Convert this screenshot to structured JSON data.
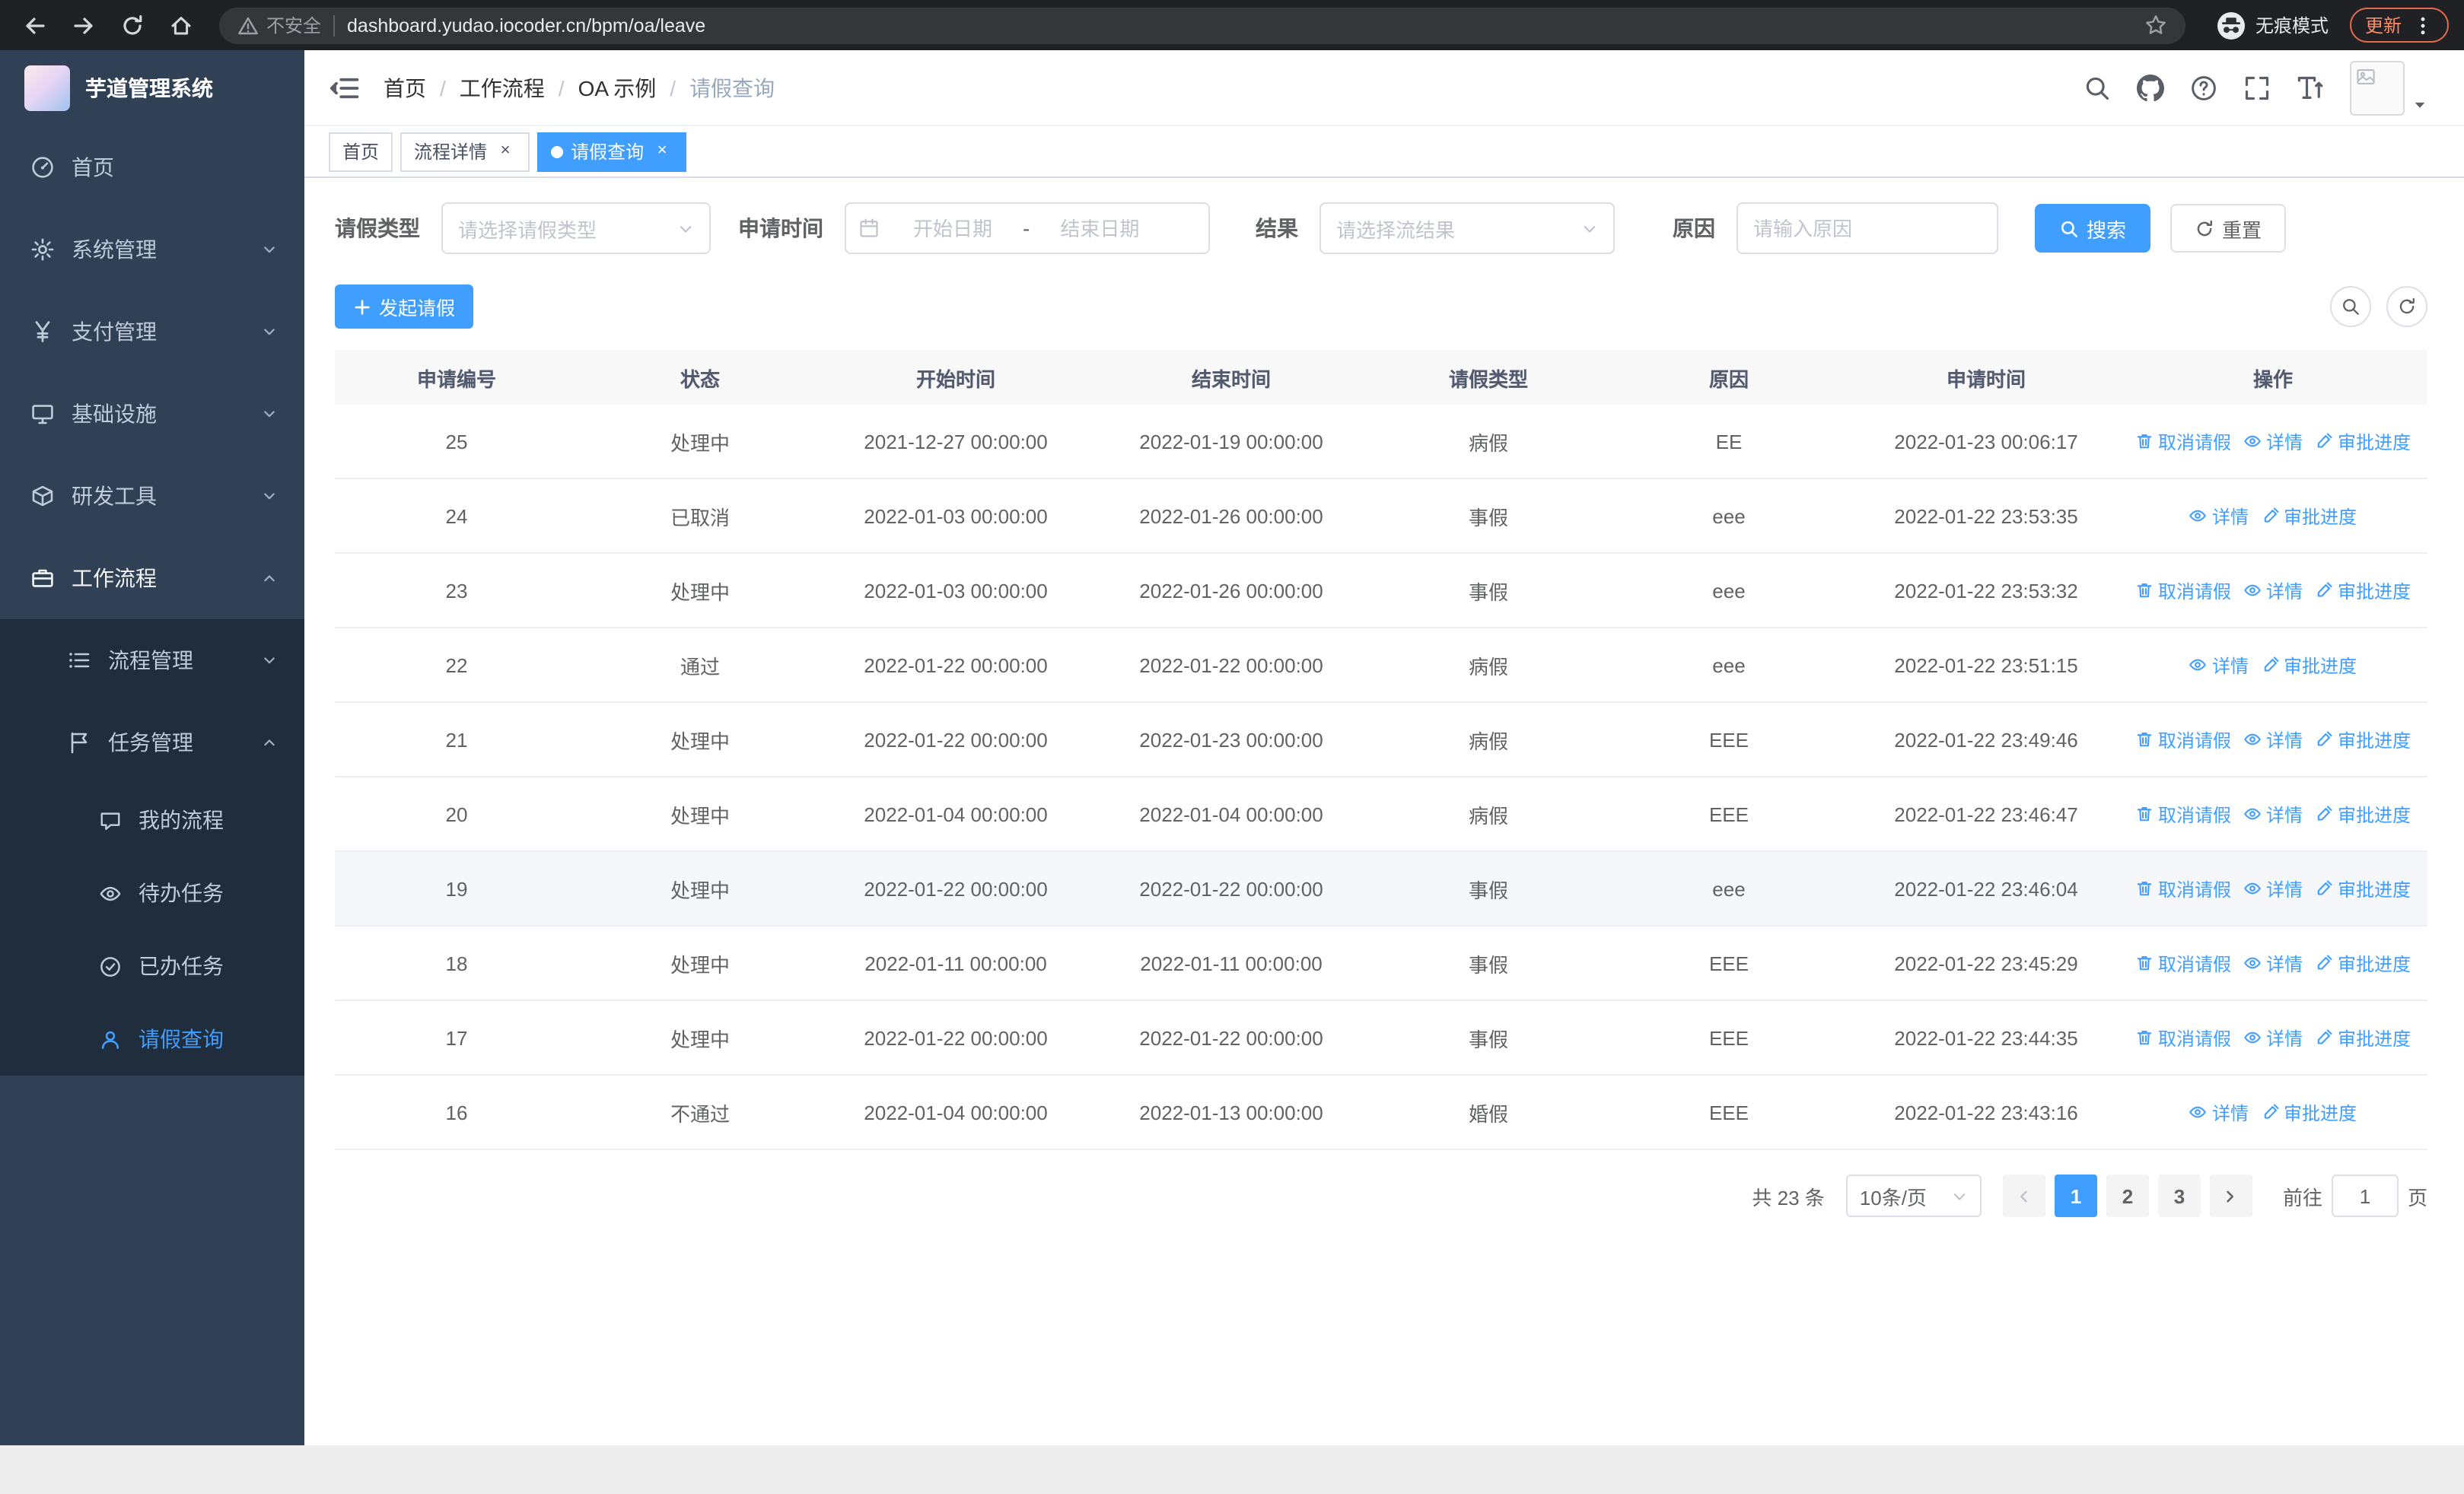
{
  "colors": {
    "accent": "#409eff",
    "sidebar_bg": "#304156",
    "submenu_bg": "#1f2d3d",
    "table_header_bg": "#f8f8f9"
  },
  "icons": {
    "security": "warning-triangle",
    "bookmark": "star",
    "incognito": "hat-and-glasses",
    "sidebar_home": "dashboard-gauge",
    "system": "gear",
    "payment": "yen",
    "infra": "monitor",
    "devtools": "cube",
    "workflow": "briefcase",
    "process": "list",
    "task": "flag",
    "my_process": "chat-bubble",
    "todo": "eye",
    "done": "check-circle",
    "leave_query": "person",
    "header": [
      "search",
      "github-octocat",
      "question-circle",
      "fullscreen",
      "font-size"
    ],
    "table_actions": [
      "trash",
      "eye",
      "edit-pen"
    ]
  },
  "browser": {
    "security_chip": "不安全",
    "url": "dashboard.yudao.iocoder.cn/bpm/oa/leave",
    "incognito_label": "无痕模式",
    "update_label": "更新"
  },
  "sidebar": {
    "logo_title": "芋道管理系统",
    "items": [
      {
        "label": "首页"
      },
      {
        "label": "系统管理"
      },
      {
        "label": "支付管理"
      },
      {
        "label": "基础设施"
      },
      {
        "label": "研发工具"
      },
      {
        "label": "工作流程"
      },
      {
        "label": "流程管理"
      },
      {
        "label": "任务管理"
      },
      {
        "label": "我的流程"
      },
      {
        "label": "待办任务"
      },
      {
        "label": "已办任务"
      },
      {
        "label": "请假查询"
      }
    ]
  },
  "breadcrumb": {
    "items": [
      "首页",
      "工作流程",
      "OA 示例",
      "请假查询"
    ]
  },
  "tabs": [
    {
      "label": "首页"
    },
    {
      "label": "流程详情"
    },
    {
      "label": "请假查询"
    }
  ],
  "filters": {
    "leave_type_label": "请假类型",
    "leave_type_placeholder": "请选择请假类型",
    "apply_time_label": "申请时间",
    "start_placeholder": "开始日期",
    "separator": "-",
    "end_placeholder": "结束日期",
    "result_label": "结果",
    "result_placeholder": "请选择流结果",
    "reason_label": "原因",
    "reason_placeholder": "请输入原因",
    "search_button": "搜索",
    "reset_button": "重置"
  },
  "toolbar": {
    "create_button": "发起请假"
  },
  "table": {
    "columns": [
      "申请编号",
      "状态",
      "开始时间",
      "结束时间",
      "请假类型",
      "原因",
      "申请时间",
      "操作"
    ],
    "actions": {
      "cancel": "取消请假",
      "detail": "详情",
      "progress": "审批进度"
    },
    "rows": [
      {
        "id": "25",
        "status": "处理中",
        "start": "2021-12-27 00:00:00",
        "end": "2022-01-19 00:00:00",
        "type": "病假",
        "reason": "EE",
        "time": "2022-01-23 00:06:17",
        "cancellable": true
      },
      {
        "id": "24",
        "status": "已取消",
        "start": "2022-01-03 00:00:00",
        "end": "2022-01-26 00:00:00",
        "type": "事假",
        "reason": "eee",
        "time": "2022-01-22 23:53:35",
        "cancellable": false
      },
      {
        "id": "23",
        "status": "处理中",
        "start": "2022-01-03 00:00:00",
        "end": "2022-01-26 00:00:00",
        "type": "事假",
        "reason": "eee",
        "time": "2022-01-22 23:53:32",
        "cancellable": true
      },
      {
        "id": "22",
        "status": "通过",
        "start": "2022-01-22 00:00:00",
        "end": "2022-01-22 00:00:00",
        "type": "病假",
        "reason": "eee",
        "time": "2022-01-22 23:51:15",
        "cancellable": false
      },
      {
        "id": "21",
        "status": "处理中",
        "start": "2022-01-22 00:00:00",
        "end": "2022-01-23 00:00:00",
        "type": "病假",
        "reason": "EEE",
        "time": "2022-01-22 23:49:46",
        "cancellable": true
      },
      {
        "id": "20",
        "status": "处理中",
        "start": "2022-01-04 00:00:00",
        "end": "2022-01-04 00:00:00",
        "type": "病假",
        "reason": "EEE",
        "time": "2022-01-22 23:46:47",
        "cancellable": true
      },
      {
        "id": "19",
        "status": "处理中",
        "start": "2022-01-22 00:00:00",
        "end": "2022-01-22 00:00:00",
        "type": "事假",
        "reason": "eee",
        "time": "2022-01-22 23:46:04",
        "cancellable": true,
        "hover": true
      },
      {
        "id": "18",
        "status": "处理中",
        "start": "2022-01-11 00:00:00",
        "end": "2022-01-11 00:00:00",
        "type": "事假",
        "reason": "EEE",
        "time": "2022-01-22 23:45:29",
        "cancellable": true
      },
      {
        "id": "17",
        "status": "处理中",
        "start": "2022-01-22 00:00:00",
        "end": "2022-01-22 00:00:00",
        "type": "事假",
        "reason": "EEE",
        "time": "2022-01-22 23:44:35",
        "cancellable": true
      },
      {
        "id": "16",
        "status": "不通过",
        "start": "2022-01-04 00:00:00",
        "end": "2022-01-13 00:00:00",
        "type": "婚假",
        "reason": "EEE",
        "time": "2022-01-22 23:43:16",
        "cancellable": false
      }
    ]
  },
  "pagination": {
    "total_text": "共 23 条",
    "page_size": "10条/页",
    "pages": [
      "1",
      "2",
      "3"
    ],
    "active_page": "1",
    "goto_label": "前往",
    "goto_value": "1",
    "unit_label": "页"
  }
}
